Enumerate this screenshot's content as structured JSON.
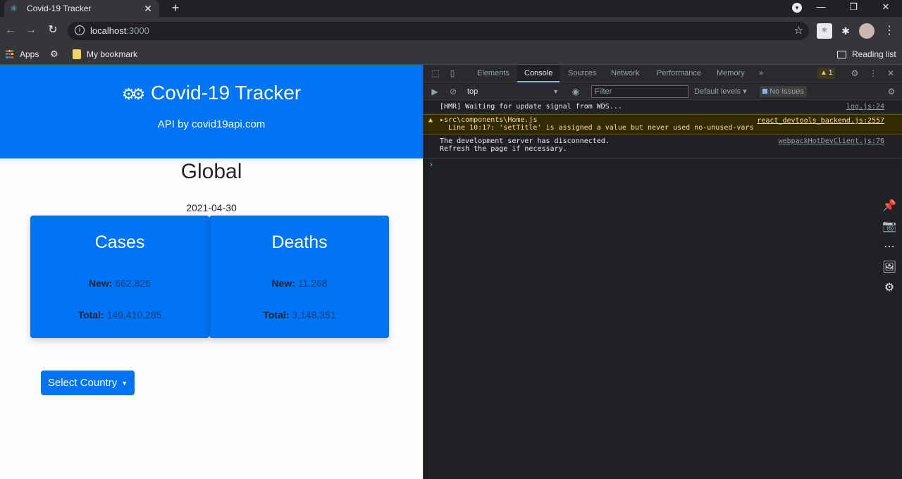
{
  "browser": {
    "tab_title": "Covid-19 Tracker",
    "tab_close": "✕",
    "new_tab": "+",
    "url_host": "localhost",
    "url_port": ":3000",
    "bookmarks": {
      "apps": "Apps",
      "my_bookmark": "My bookmark",
      "reading_list": "Reading list"
    }
  },
  "app": {
    "title": "Covid-19 Tracker",
    "subtitle": "API by covid19api.com",
    "section_title": "Global",
    "date": "2021-04-30",
    "cards": [
      {
        "title": "Cases",
        "new_label": "New:",
        "new_value": "662,826",
        "total_label": "Total:",
        "total_value": "149,410,285"
      },
      {
        "title": "Deaths",
        "new_label": "New:",
        "new_value": "11,268",
        "total_label": "Total:",
        "total_value": "3,148,351"
      }
    ],
    "select_button": "Select Country",
    "colors": {
      "primary": "#0074f7"
    }
  },
  "devtools": {
    "tabs": [
      "Elements",
      "Console",
      "Sources",
      "Network",
      "Performance",
      "Memory"
    ],
    "active_tab": "Console",
    "more_tabs": "»",
    "warning_count": "1",
    "context": "top",
    "filter_placeholder": "Filter",
    "levels": "Default levels ▾",
    "issues": "No Issues",
    "logs": [
      {
        "text": "[HMR] Waiting for update signal from WDS...",
        "source": "log.js:24"
      },
      {
        "line1": "▸src\\components\\Home.js",
        "line2": "Line 10:17:  'setTitle' is assigned a value but never used  no-unused-vars",
        "source": "react_devtools_backend.js:2557"
      },
      {
        "line1": "The development server has disconnected.",
        "line2": "Refresh the page if necessary.",
        "source": "webpackHotDevClient.js:76"
      }
    ]
  }
}
